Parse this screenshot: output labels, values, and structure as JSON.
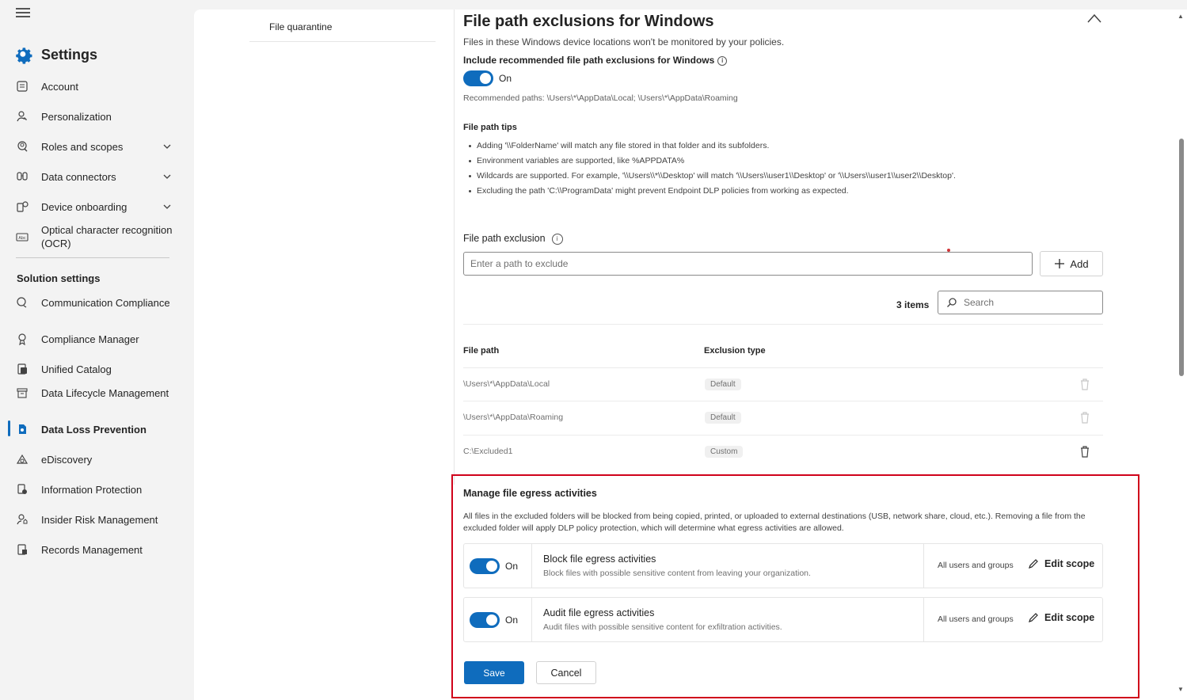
{
  "nav": {
    "title": "Settings",
    "items": [
      {
        "label": "Account",
        "icon": "account-icon"
      },
      {
        "label": "Personalization",
        "icon": "personalization-icon"
      },
      {
        "label": "Roles and scopes",
        "icon": "roles-icon",
        "expandable": true
      },
      {
        "label": "Data connectors",
        "icon": "connectors-icon",
        "expandable": true
      },
      {
        "label": "Device onboarding",
        "icon": "device-icon",
        "expandable": true
      },
      {
        "label": "Optical character recognition (OCR)",
        "icon": "ocr-icon"
      }
    ],
    "section_label": "Solution settings",
    "solutions": [
      {
        "label": "Communication Compliance",
        "icon": "communication-icon"
      },
      {
        "label": "Compliance Manager",
        "icon": "compliance-manager-icon"
      },
      {
        "label": "Unified Catalog",
        "icon": "catalog-icon"
      },
      {
        "label": "Data Lifecycle Management",
        "icon": "lifecycle-icon"
      },
      {
        "label": "Data Loss Prevention",
        "icon": "dlp-icon",
        "active": true
      },
      {
        "label": "eDiscovery",
        "icon": "ediscovery-icon"
      },
      {
        "label": "Information Protection",
        "icon": "info-protection-icon"
      },
      {
        "label": "Insider Risk Management",
        "icon": "insider-risk-icon"
      },
      {
        "label": "Records Management",
        "icon": "records-icon"
      }
    ]
  },
  "subnav": {
    "item": "File quarantine"
  },
  "panel": {
    "title": "File path exclusions for Windows",
    "desc": "Files in these Windows device locations won't be monitored by your policies.",
    "include_label": "Include recommended file path exclusions for Windows",
    "include_state": "On",
    "recommended": "Recommended paths: \\Users\\*\\AppData\\Local; \\Users\\*\\AppData\\Roaming",
    "tips_title": "File path tips",
    "tips": [
      "Adding '\\\\FolderName' will match any file stored in that folder and its subfolders.",
      "Environment variables are supported, like %APPDATA%",
      "Wildcards are supported. For example, '\\\\Users\\\\*\\\\Desktop' will match '\\\\Users\\\\user1\\\\Desktop' or '\\\\Users\\\\user1\\\\user2\\\\Desktop'.",
      "Excluding the path 'C:\\\\ProgramData' might prevent Endpoint DLP policies from working as expected."
    ],
    "exclusion_label": "File path exclusion",
    "exclusion_placeholder": "Enter a path to exclude",
    "add_label": "Add",
    "items_count": "3 items",
    "search_placeholder": "Search",
    "table": {
      "headers": [
        "File path",
        "Exclusion type"
      ],
      "rows": [
        {
          "path": "\\Users\\*\\AppData\\Local",
          "type": "Default"
        },
        {
          "path": "\\Users\\*\\AppData\\Roaming",
          "type": "Default"
        },
        {
          "path": "C:\\Excluded1",
          "type": "Custom"
        }
      ]
    }
  },
  "egress": {
    "title": "Manage file egress activities",
    "desc": "All files in the excluded folders will be blocked from being copied, printed, or uploaded to external destinations (USB, network share, cloud, etc.). Removing a file from the excluded folder will apply DLP policy protection, which will determine what egress activities are allowed.",
    "rows": [
      {
        "state": "On",
        "title": "Block file egress activities",
        "sub": "Block files with possible sensitive content from leaving your organization.",
        "scope": "All users and groups",
        "edit": "Edit scope"
      },
      {
        "state": "On",
        "title": "Audit file egress activities",
        "sub": "Audit files with possible sensitive content for exfiltration activities.",
        "scope": "All users and groups",
        "edit": "Edit scope"
      }
    ],
    "save": "Save",
    "cancel": "Cancel"
  },
  "colors": {
    "accent": "#0f6cbd",
    "highlight": "#d0021b"
  }
}
